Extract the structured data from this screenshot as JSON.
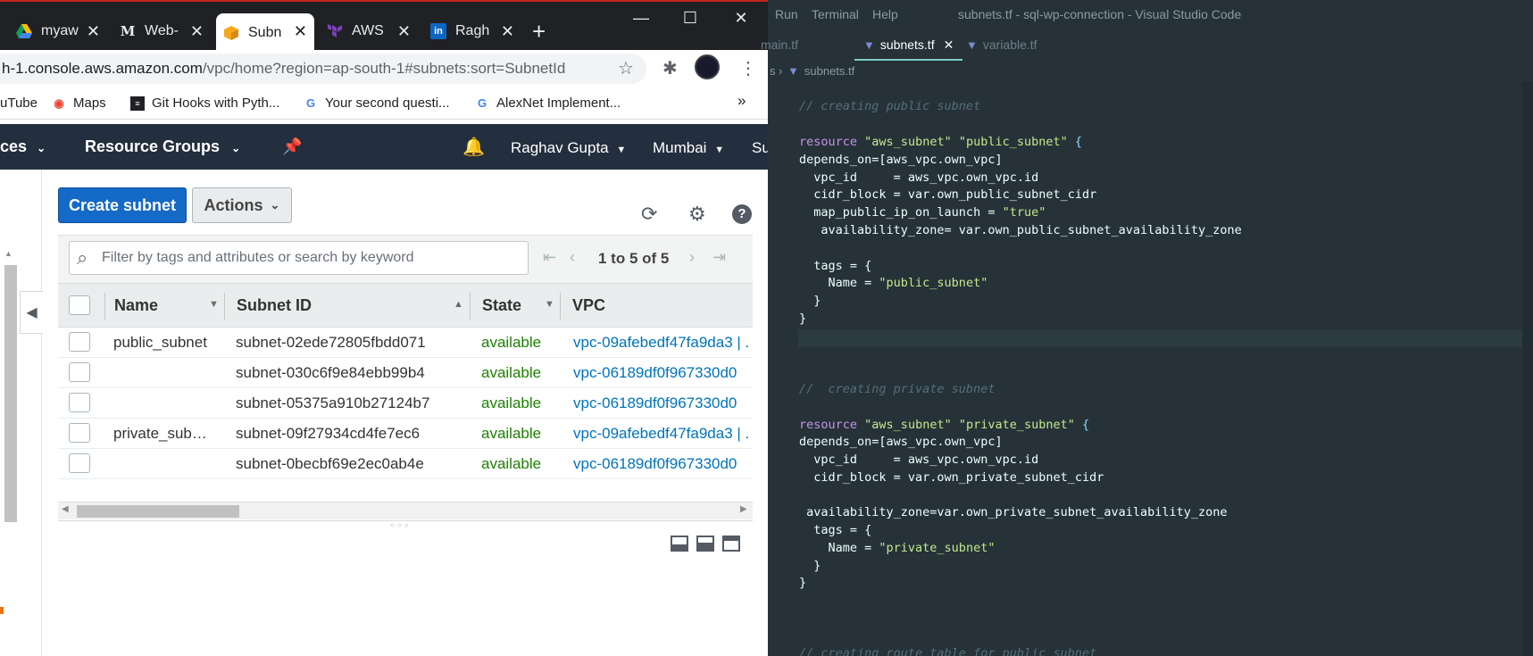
{
  "browser": {
    "tabs": [
      {
        "label": "myaw",
        "icon": "drive-icon"
      },
      {
        "label": "Web-",
        "icon": "medium-icon"
      },
      {
        "label": "Subn",
        "icon": "aws-box-icon"
      },
      {
        "label": "AWS",
        "icon": "terraform-icon"
      },
      {
        "label": "Ragh",
        "icon": "linkedin-icon"
      }
    ],
    "url_main": "h-1.console.aws.amazon.com",
    "url_path": "/vpc/home?region=ap-south-1#subnets:sort=SubnetId",
    "bookmarks": [
      "uTube",
      "Maps",
      "Git Hooks with Pyth...",
      "Your second questi...",
      "AlexNet Implement..."
    ],
    "bookmarks_more": "»"
  },
  "aws": {
    "nav": {
      "services": "ces",
      "resource_groups": "Resource Groups",
      "user": "Raghav Gupta",
      "region": "Mumbai",
      "support": "Su"
    },
    "create_label": "Create subnet",
    "actions_label": "Actions",
    "filter_placeholder": "Filter by tags and attributes or search by keyword",
    "pagination": "1 to 5 of 5",
    "columns": [
      "Name",
      "Subnet ID",
      "State",
      "VPC"
    ],
    "rows": [
      {
        "name": "public_subnet",
        "id": "subnet-02ede72805fbdd071",
        "state": "available",
        "vpc": "vpc-09afebedf47fa9da3 | ."
      },
      {
        "name": "",
        "id": "subnet-030c6f9e84ebb99b4",
        "state": "available",
        "vpc": "vpc-06189df0f967330d0"
      },
      {
        "name": "",
        "id": "subnet-05375a910b27124b7",
        "state": "available",
        "vpc": "vpc-06189df0f967330d0"
      },
      {
        "name": "private_sub…",
        "id": "subnet-09f27934cd4fe7ec6",
        "state": "available",
        "vpc": "vpc-09afebedf47fa9da3 | ."
      },
      {
        "name": "",
        "id": "subnet-0becbf69e2ec0ab4e",
        "state": "available",
        "vpc": "vpc-06189df0f967330d0"
      }
    ]
  },
  "vscode": {
    "menu": [
      "Run",
      "Terminal",
      "Help"
    ],
    "title": "subnets.tf - sql-wp-connection - Visual Studio Code",
    "tabs": [
      "main.tf",
      "subnets.tf",
      "variable.tf"
    ],
    "breadcrumb": "subnets.tf",
    "code": {
      "c1": "// creating public subnet",
      "l_res1_kw": "resource",
      "l_res1_a": "\"aws_subnet\"",
      "l_res1_b": "\"public_subnet\"",
      "l_dep1": "depends_on=[aws_vpc.own_vpc]",
      "l_vpc1": "  vpc_id     = aws_vpc.own_vpc.id",
      "l_cidr1": "  cidr_block = var.own_public_subnet_cidr",
      "l_map1_a": "  map_public_ip_on_launch = ",
      "l_map1_b": "\"true\"",
      "l_az1": "   availability_zone= var.own_public_subnet_availability_zone",
      "l_tags1": "  tags = {",
      "l_name1_a": "    Name = ",
      "l_name1_b": "\"public_subnet\"",
      "l_close_inner": "  }",
      "l_close": "}",
      "c2": "//  creating private subnet",
      "l_res2_a": "\"aws_subnet\"",
      "l_res2_b": "\"private_subnet\"",
      "l_vpc2": "  vpc_id     = aws_vpc.own_vpc.id",
      "l_cidr2": "  cidr_block = var.own_private_subnet_cidr",
      "l_az2": " availability_zone=var.own_private_subnet_availability_zone",
      "l_name2_b": "\"private_subnet\"",
      "c3": "// creating route table for public subnet"
    }
  }
}
